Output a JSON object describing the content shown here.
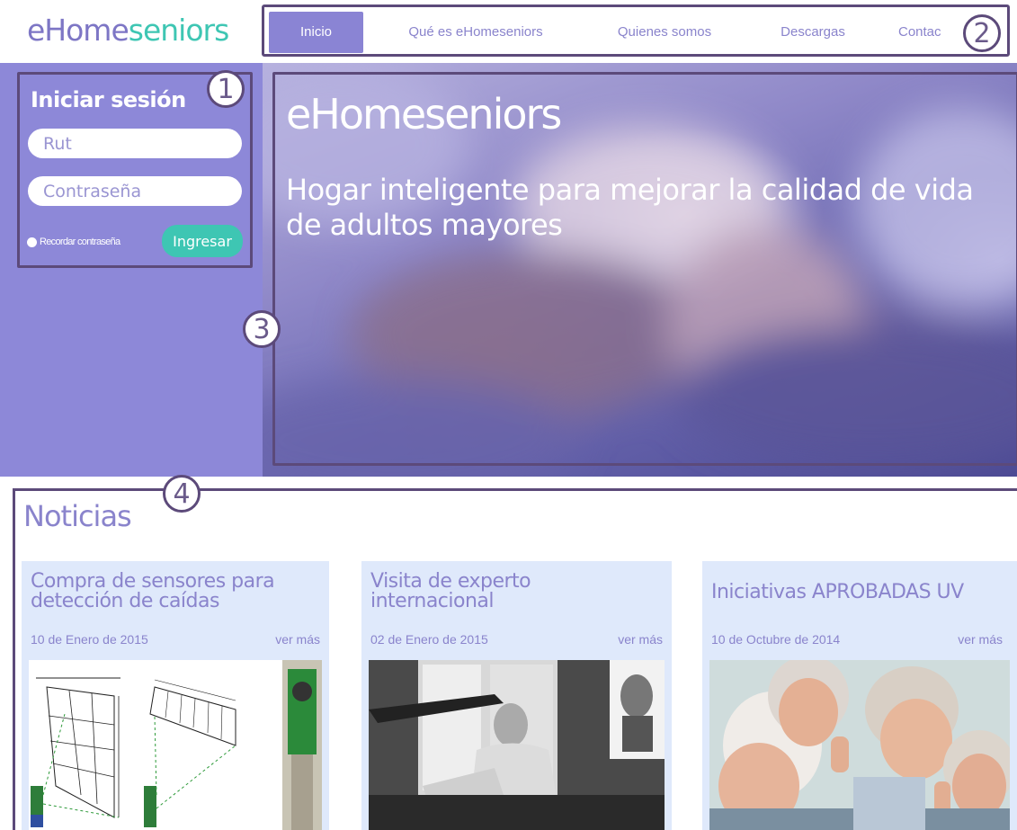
{
  "logo": {
    "part1": "eHome",
    "part2": "seniors"
  },
  "nav": {
    "items": [
      {
        "label": "Inicio"
      },
      {
        "label": "Qué es eHomeseniors"
      },
      {
        "label": "Quienes somos"
      },
      {
        "label": "Descargas"
      },
      {
        "label": "Contac"
      }
    ]
  },
  "login": {
    "title": "Iniciar sesión",
    "rut_placeholder": "Rut",
    "password_placeholder": "Contraseña",
    "remember_label": "Recordar contraseña",
    "submit_label": "Ingresar"
  },
  "hero": {
    "title": "eHomeseniors",
    "subtitle": "Hogar inteligente para mejorar la calidad de vida de adultos mayores"
  },
  "markers": [
    "1",
    "2",
    "3",
    "4"
  ],
  "news": {
    "heading": "Noticias",
    "cards": [
      {
        "title": "Compra de sensores para detección de caídas",
        "date": "10 de Enero de 2015",
        "more": "ver más"
      },
      {
        "title": "Visita de experto internacional",
        "date": "02 de Enero de 2015",
        "more": "ver más"
      },
      {
        "title": "Iniciativas APROBADAS UV",
        "date": "10 de Octubre de 2014",
        "more": "ver más"
      }
    ]
  },
  "colors": {
    "brand_purple": "#8a84cc",
    "brand_teal": "#3ec6b3",
    "sidebar_bg": "#8d88d8",
    "annotation": "#5c4a7a",
    "card_bg": "#dfe9fb"
  }
}
